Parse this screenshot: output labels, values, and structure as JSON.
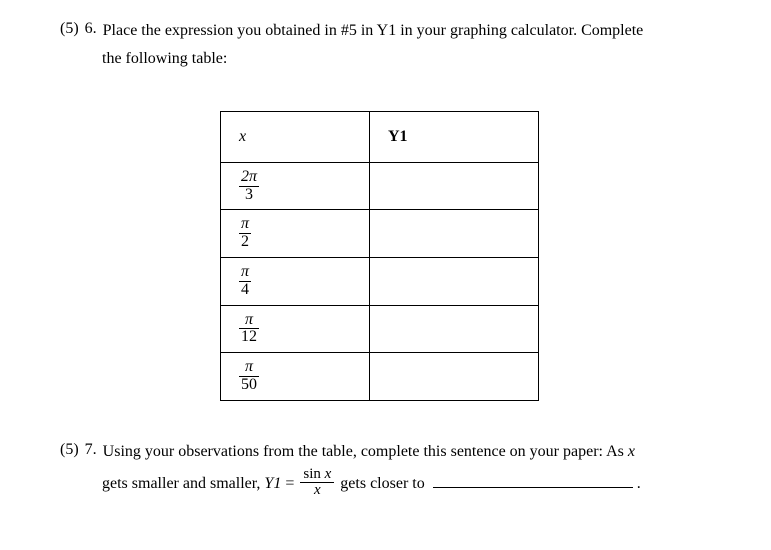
{
  "q6": {
    "points": "(5)",
    "number": "6.",
    "text_line1": "Place the expression you obtained in #5 in Y1 in your graphing calculator. Complete",
    "text_line2": "the following table:"
  },
  "table": {
    "header_x": "x",
    "header_y1": "Y1",
    "rows": [
      {
        "num": "2π",
        "den": "3",
        "y1": ""
      },
      {
        "num": "π",
        "den": "2",
        "y1": ""
      },
      {
        "num": "π",
        "den": "4",
        "y1": ""
      },
      {
        "num": "π",
        "den": "12",
        "y1": ""
      },
      {
        "num": "π",
        "den": "50",
        "y1": ""
      }
    ]
  },
  "q7": {
    "points": "(5)",
    "number": "7.",
    "text_line1": "Using your observations from the table, complete this sentence on your paper: As",
    "var_x": "x",
    "text_line2a": "gets smaller and smaller,",
    "y1_label": "Y1",
    "equals": "=",
    "frac_num": "sin",
    "frac_num_var": "x",
    "frac_den": "x",
    "text_line2b": "gets closer to",
    "period": "."
  }
}
